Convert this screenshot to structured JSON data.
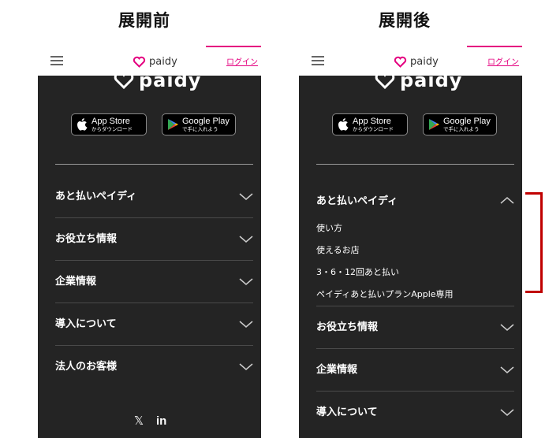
{
  "captions": {
    "before": "展開前",
    "after": "展開後"
  },
  "header": {
    "brand": "paidy",
    "login": "ログイン"
  },
  "footer_logo": "paidy",
  "stores": {
    "apple": {
      "top": "App Store",
      "bottom": "からダウンロード"
    },
    "google": {
      "top": "Google Play",
      "bottom": "で手に入れよう"
    }
  },
  "before": {
    "menu": [
      "あと払いペイディ",
      "お役立ち情報",
      "企業情報",
      "導入について",
      "法人のお客様"
    ]
  },
  "after": {
    "expanded": "あと払いペイディ",
    "submenu": [
      "使い方",
      "使えるお店",
      "3・6・12回あと払い",
      "ペイディあと払いプランApple専用"
    ],
    "menu": [
      "お役立ち情報",
      "企業情報",
      "導入について"
    ]
  },
  "social": {
    "x": "𝕏",
    "linkedin": "in"
  },
  "colors": {
    "accent": "#e4007f",
    "panel": "#242424",
    "highlight": "#c00000"
  }
}
